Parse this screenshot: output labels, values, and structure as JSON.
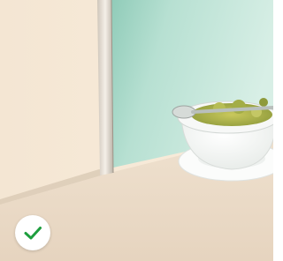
{
  "photo": {
    "subject": "",
    "colors": {
      "wall": "#f6e7d3",
      "frosted_glass": "#a9d6c6",
      "countertop": "#eadbc6",
      "bowl": "#ffffff"
    }
  },
  "selection_badge": {
    "icon": "checkmark-icon",
    "selected": true,
    "colors": {
      "check": "#1e9e3e",
      "background": "#ffffff"
    }
  }
}
